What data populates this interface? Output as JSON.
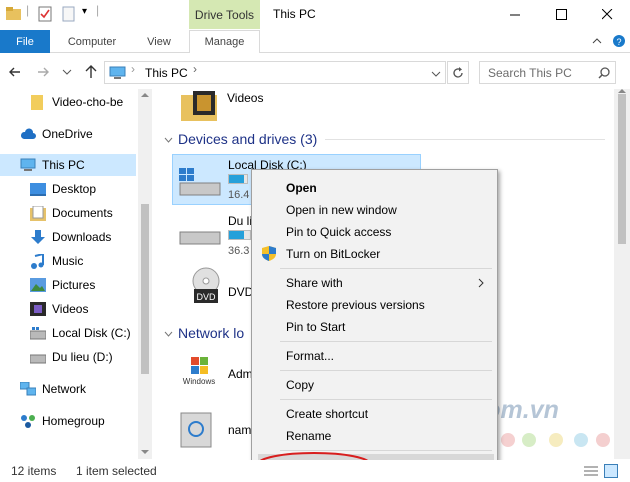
{
  "window": {
    "title": "This PC",
    "contextual_tab_group": "Drive Tools"
  },
  "ribbon": {
    "tabs": [
      "File",
      "Computer",
      "View",
      "Manage"
    ]
  },
  "address": {
    "path": [
      "This PC"
    ],
    "search_placeholder": "Search This PC"
  },
  "sidebar": {
    "items": [
      {
        "label": "Video-cho-be",
        "icon": "folder-icon"
      },
      {
        "label": "OneDrive",
        "icon": "cloud-icon"
      },
      {
        "label": "This PC",
        "icon": "computer-icon",
        "selected": true
      },
      {
        "label": "Desktop",
        "icon": "desktop-icon"
      },
      {
        "label": "Documents",
        "icon": "documents-icon"
      },
      {
        "label": "Downloads",
        "icon": "download-icon"
      },
      {
        "label": "Music",
        "icon": "music-icon"
      },
      {
        "label": "Pictures",
        "icon": "pictures-icon"
      },
      {
        "label": "Videos",
        "icon": "videos-icon"
      },
      {
        "label": "Local Disk (C:)",
        "icon": "drive-icon"
      },
      {
        "label": "Du lieu (D:)",
        "icon": "drive-icon"
      },
      {
        "label": "Network",
        "icon": "network-icon"
      },
      {
        "label": "Homegroup",
        "icon": "homegroup-icon"
      }
    ]
  },
  "main": {
    "folder_videos": "Videos",
    "devices_heading": "Devices and drives (3)",
    "drives": [
      {
        "name": "Local Disk (C:)",
        "free_prefix": "16.4",
        "used_fraction": 0.85
      },
      {
        "name": "Du li",
        "free_prefix": "36.3",
        "used_fraction": 0.7
      },
      {
        "name": "DVD",
        "free_prefix": "",
        "used_fraction": 0
      }
    ],
    "network_heading": "Network lo",
    "network_items": [
      "Adm",
      "nam"
    ]
  },
  "context_menu": {
    "items": [
      {
        "label": "Open",
        "bold": true
      },
      {
        "label": "Open in new window"
      },
      {
        "label": "Pin to Quick access"
      },
      {
        "label": "Turn on BitLocker",
        "icon": "shield-icon"
      },
      {
        "label": "Share with",
        "submenu": true
      },
      {
        "label": "Restore previous versions"
      },
      {
        "label": "Pin to Start"
      },
      {
        "label": "Format..."
      },
      {
        "label": "Copy"
      },
      {
        "label": "Create shortcut"
      },
      {
        "label": "Rename"
      },
      {
        "label": "Properties",
        "highlighted": true
      }
    ]
  },
  "status": {
    "items_count": "12 items",
    "selected": "1 item selected"
  },
  "watermark": {
    "text": "Download.com.vn"
  },
  "colors": {
    "accent": "#1979ca",
    "selection": "#cce8ff",
    "drive_bar": "#26a0da",
    "drive_tools": "#d5e8b3",
    "annotation": "#d81e1e"
  }
}
